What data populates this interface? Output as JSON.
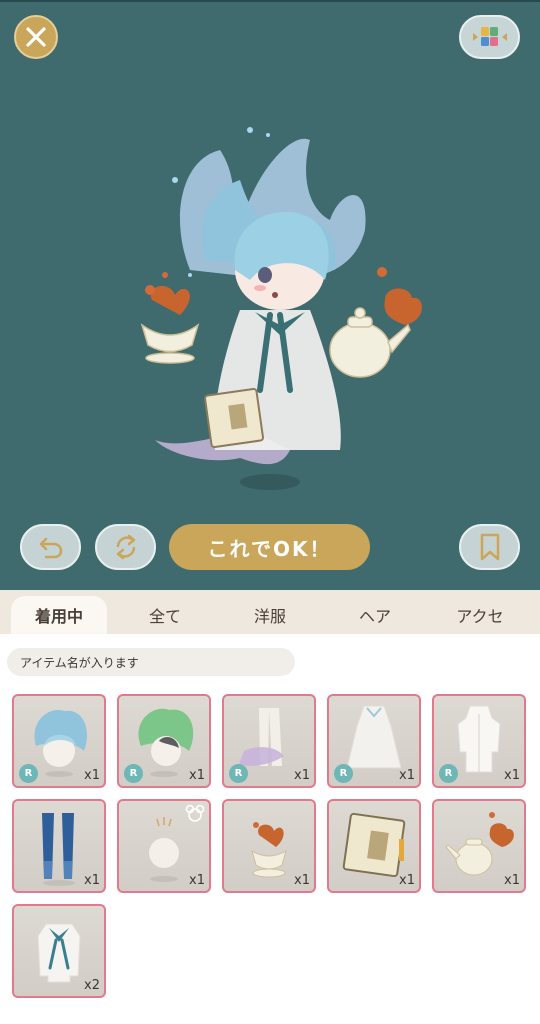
{
  "header": {
    "close_icon": "close-icon",
    "menu_icon": "grid-menu-icon"
  },
  "toolbar": {
    "undo_icon": "undo-icon",
    "rotate_icon": "rotate-icon",
    "ok_label": "これでOK！",
    "bookmark_icon": "bookmark-icon"
  },
  "tabs": [
    {
      "label": "着用中",
      "active": true
    },
    {
      "label": "全て",
      "active": false
    },
    {
      "label": "洋服",
      "active": false
    },
    {
      "label": "ヘア",
      "active": false
    },
    {
      "label": "アクセ",
      "active": false
    }
  ],
  "item_name_placeholder": "アイテム名が入ります",
  "items": [
    {
      "name": "blue-hair",
      "rarity": "R",
      "qty": "x1"
    },
    {
      "name": "green-hair",
      "rarity": "R",
      "qty": "x1"
    },
    {
      "name": "mermaid-tail-leggings",
      "rarity": "R",
      "qty": "x1"
    },
    {
      "name": "white-sheer-dress",
      "rarity": "R",
      "qty": "x1"
    },
    {
      "name": "white-coat",
      "rarity": "R",
      "qty": "x1"
    },
    {
      "name": "blue-stockings",
      "rarity": "",
      "qty": "x1"
    },
    {
      "name": "face-base",
      "rarity": "",
      "qty": "x1"
    },
    {
      "name": "teacup-accessory",
      "rarity": "",
      "qty": "x1"
    },
    {
      "name": "book-accessory",
      "rarity": "",
      "qty": "x1"
    },
    {
      "name": "teapot-accessory",
      "rarity": "",
      "qty": "x1"
    },
    {
      "name": "bow-shirt",
      "rarity": "",
      "qty": "x2"
    }
  ],
  "colors": {
    "stage_bg": "#3f6a6e",
    "accent_gold": "#c9a659",
    "slot_border": "#e27a8e",
    "rarity_badge": "#6fb6b6"
  }
}
